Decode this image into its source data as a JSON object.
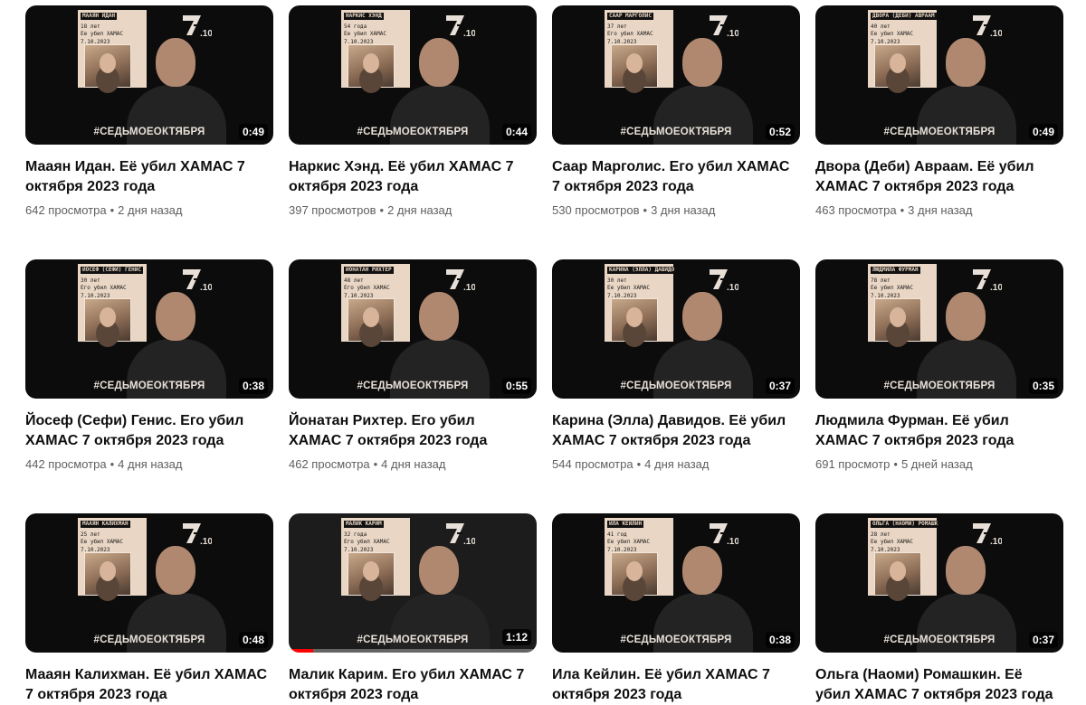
{
  "hashtag": "#СЕДЬМОЕОКТЯБРЯ",
  "colors": {
    "card_bg": "#e9d6c4",
    "thumb_bg": "#0c0c0c",
    "progress": "#ff0000",
    "meta_text": "#606060"
  },
  "videos": [
    {
      "title": "Мааян Идан. Её убил ХАМАС 7 октября 2023 года",
      "views": "642 просмотра",
      "age": "2 дня назад",
      "duration": "0:49",
      "card": {
        "name": "МААЯН ИДАН",
        "age": "18 лет",
        "killed": "Ее убил ХАМАС",
        "date": "7.10.2023"
      }
    },
    {
      "title": "Наркис Хэнд. Её убил ХАМАС 7 октября 2023 года",
      "views": "397 просмотров",
      "age": "2 дня назад",
      "duration": "0:44",
      "card": {
        "name": "НАРКИС ХЭНД",
        "age": "54 года",
        "killed": "Ее убил ХАМАС",
        "date": "7.10.2023"
      }
    },
    {
      "title": "Саар Марголис. Его убил ХАМАС 7 октября 2023 года",
      "views": "530 просмотров",
      "age": "3 дня назад",
      "duration": "0:52",
      "card": {
        "name": "СААР МАРГОЛИС",
        "age": "37 лет",
        "killed": "Его убил ХАМАС",
        "date": "7.10.2023"
      }
    },
    {
      "title": "Двора (Деби) Авраам. Её убил ХАМАС 7 октября 2023 года",
      "views": "463 просмотра",
      "age": "3 дня назад",
      "duration": "0:49",
      "card": {
        "name": "ДВОРА (ДЕБИ) АВРААМ",
        "age": "40 лет",
        "killed": "Ее убил ХАМАС",
        "date": "7.10.2023"
      }
    },
    {
      "title": "Йосеф (Сефи) Генис. Его убил ХАМАС 7 октября 2023 года",
      "views": "442 просмотра",
      "age": "4 дня назад",
      "duration": "0:38",
      "card": {
        "name": "ЙОСЕФ (СЕФИ) ГЕНИС",
        "age": "30 лет",
        "killed": "Его убил ХАМАС",
        "date": "7.10.2023"
      }
    },
    {
      "title": "Йонатан Рихтер. Его убил ХАМАС 7 октября 2023 года",
      "views": "462 просмотра",
      "age": "4 дня назад",
      "duration": "0:55",
      "card": {
        "name": "ЙОНАТАН РИХТЕР",
        "age": "48 лет",
        "killed": "Его убил ХАМАС",
        "date": "7.10.2023"
      }
    },
    {
      "title": "Карина (Элла) Давидов. Её убил ХАМАС 7 октября 2023 года",
      "views": "544 просмотра",
      "age": "4 дня назад",
      "duration": "0:37",
      "card": {
        "name": "КАРИНА (ЭЛЛА) ДАВИДОВ",
        "age": "30 лет",
        "killed": "Ее убил ХАМАС",
        "date": "7.10.2023"
      }
    },
    {
      "title": "Людмила Фурман. Её убил ХАМАС 7 октября 2023 года",
      "views": "691 просмотр",
      "age": "5 дней назад",
      "duration": "0:35",
      "card": {
        "name": "ЛЮДМИЛА ФУРМАН",
        "age": "78 лет",
        "killed": "Ее убил ХАМАС",
        "date": "7.10.2023"
      }
    },
    {
      "title": "Мааян Калихман. Её убил ХАМАС 7 октября 2023 года",
      "views": "",
      "age": "",
      "duration": "0:48",
      "card": {
        "name": "МААЯН КАЛИХМАН",
        "age": "25 лет",
        "killed": "Ее убил ХАМАС",
        "date": "7.10.2023"
      }
    },
    {
      "title": "Малик Карим. Его убил ХАМАС 7 октября 2023 года",
      "views": "",
      "age": "",
      "duration": "1:12",
      "progress": 0.1,
      "card": {
        "name": "МАЛИК КАРИМ",
        "age": "32 года",
        "killed": "Его убил ХАМАС",
        "date": "7.10.2023"
      }
    },
    {
      "title": "Ила Кейлин. Её убил ХАМАС 7 октября 2023 года",
      "views": "",
      "age": "",
      "duration": "0:38",
      "card": {
        "name": "ИЛА КЕЙЛИН",
        "age": "41 год",
        "killed": "Ее убил ХАМАС",
        "date": "7.10.2023"
      }
    },
    {
      "title": "Ольга (Наоми) Ромашкин. Её убил ХАМАС 7 октября 2023 года",
      "views": "",
      "age": "",
      "duration": "0:37",
      "card": {
        "name": "ОЛЬГА (НАОМИ) РОМАШКИН",
        "age": "28 лет",
        "killed": "Ее убил ХАМАС",
        "date": "7.10.2023"
      }
    }
  ]
}
